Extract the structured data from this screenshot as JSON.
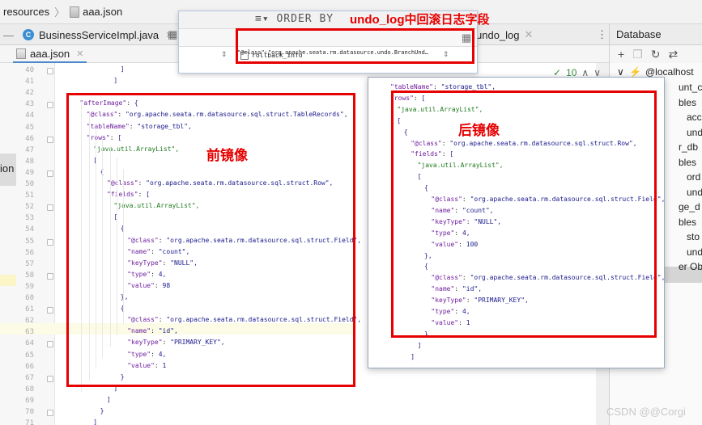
{
  "breadcrumb": {
    "folder": "resources",
    "file": "aaa.json"
  },
  "tabs": {
    "java_tab": "BusinessServiceImpl.java",
    "undo_tab": "undo_log",
    "json_tab": "aaa.json",
    "db_panel": "Database"
  },
  "popup": {
    "order_by": "ORDER BY",
    "column": "rollback_info",
    "cell": "\"@class\":\"org.apache.seata.rm.datasource.undo.BranchUnd…",
    "annotation": "undo_log中回滚日志字段"
  },
  "warnings": {
    "count": "10"
  },
  "left_edge_text": "ion",
  "annotations": {
    "before": "前镜像",
    "after": "后镜像"
  },
  "db_tree": {
    "host": "@localhost",
    "items": [
      "unt_c",
      "bles",
      "acc",
      "und",
      "r_db",
      "bles",
      "ord",
      "und",
      "ge_d",
      "bles",
      "sto",
      "und",
      "er Ob"
    ]
  },
  "line_numbers": [
    "40",
    "41",
    "42",
    "43",
    "44",
    "45",
    "46",
    "47",
    "48",
    "49",
    "50",
    "51",
    "52",
    "53",
    "54",
    "55",
    "56",
    "57",
    "58",
    "59",
    "60",
    "61",
    "62",
    "63",
    "64",
    "65",
    "66",
    "67",
    "68",
    "69",
    "70",
    "71"
  ],
  "code_left": {
    "l40": "]",
    "l41": "]",
    "after_image": "\"afterImage\": {",
    "class1": "\"@class\": \"org.apache.seata.rm.datasource.sql.struct.TableRecords\",",
    "table": "\"tableName\": \"storage_tbl\",",
    "rows": "\"rows\": [",
    "alist1": "\"java.util.ArrayList\",",
    "br1": "[",
    "ob1": "{",
    "class_row": "\"@class\": \"org.apache.seata.rm.datasource.sql.struct.Row\",",
    "fields": "\"fields\": [",
    "alist2": "\"java.util.ArrayList\",",
    "br2": "[",
    "ob2": "{",
    "class_f1": "\"@class\": \"org.apache.seata.rm.datasource.sql.struct.Field\",",
    "name_count": "\"name\": \"count\",",
    "keytype_null": "\"keyType\": \"NULL\",",
    "type4a": "\"type\": 4,",
    "value98": "\"value\": 98",
    "cb1": "},",
    "ob3": "{",
    "class_f2": "\"@class\": \"org.apache.seata.rm.datasource.sql.struct.Field\",",
    "name_id": "\"name\": \"id\",",
    "keytype_pk": "\"keyType\": \"PRIMARY_KEY\",",
    "type4b": "\"type\": 4,",
    "value1": "\"value\": 1",
    "cb2": "}",
    "cb3": "]",
    "cb4": "]",
    "cb5": "}",
    "cb6": "]",
    "cb7": "]"
  },
  "code_right": {
    "table": "\"tableName\": \"storage_tbl\",",
    "rows": "\"rows\": [",
    "alist1": "\"java.util.ArrayList\",",
    "br1": "[",
    "ob1": "{",
    "class_row": "\"@class\": \"org.apache.seata.rm.datasource.sql.struct.Row\",",
    "fields": "\"fields\": [",
    "alist2": "\"java.util.ArrayList\",",
    "br2": "[",
    "ob2": "{",
    "class_f1": "\"@class\": \"org.apache.seata.rm.datasource.sql.struct.Field\",",
    "name_count": "\"name\": \"count\",",
    "keytype_null": "\"keyType\": \"NULL\",",
    "type4a": "\"type\": 4,",
    "value100": "\"value\": 100",
    "cb1": "},",
    "ob3": "{",
    "class_f2": "\"@class\": \"org.apache.seata.rm.datasource.sql.struct.Field\",",
    "name_id": "\"name\": \"id\",",
    "keytype_pk": "\"keyType\": \"PRIMARY_KEY\",",
    "type4b": "\"type\": 4,",
    "value1": "\"value\": 1",
    "cb2": "}",
    "cb3": "]",
    "cb4": "]"
  },
  "watermark": "CSDN @@Corgi",
  "colors": {
    "annotation_red": "#e60000",
    "accent_blue": "#4a88c7"
  }
}
